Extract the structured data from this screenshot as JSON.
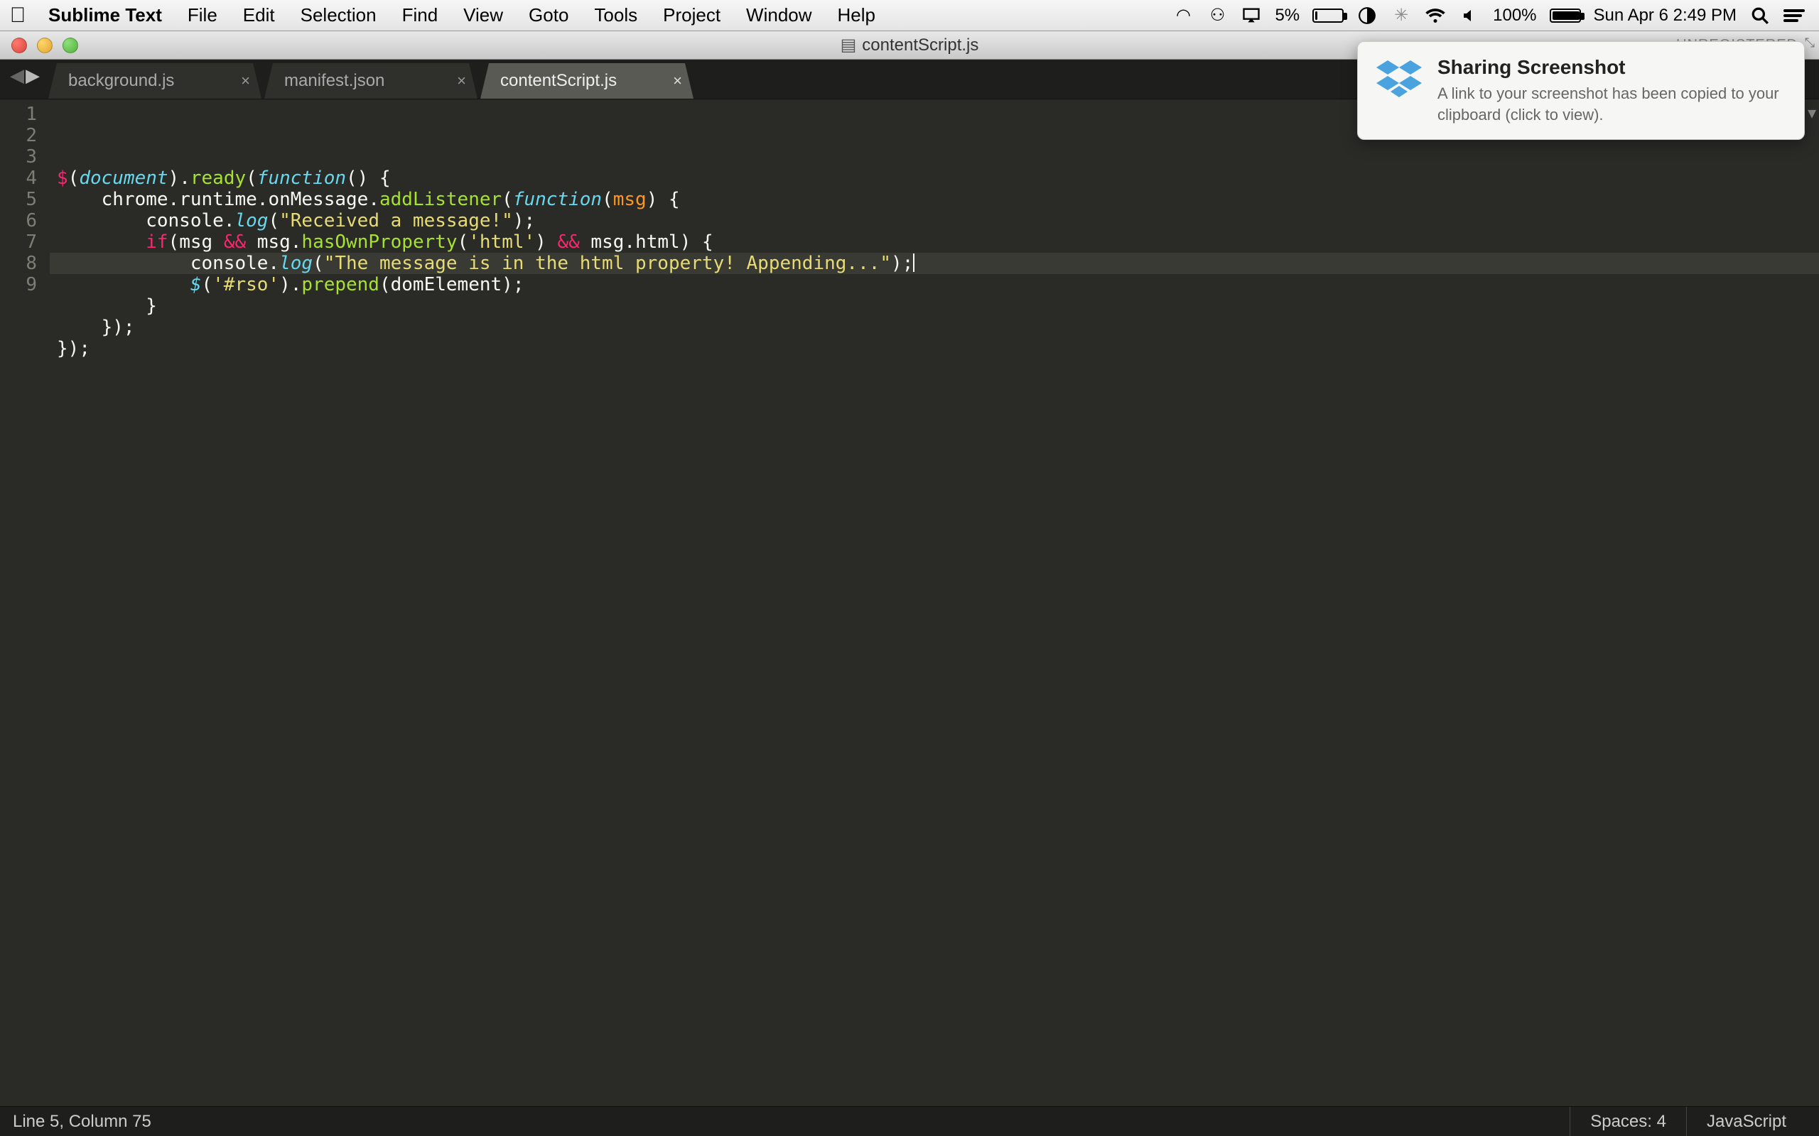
{
  "menubar": {
    "app_name": "Sublime Text",
    "items": [
      "File",
      "Edit",
      "Selection",
      "Find",
      "View",
      "Goto",
      "Tools",
      "Project",
      "Window",
      "Help"
    ],
    "tray": {
      "battery1_pct": "5%",
      "battery2_pct": "100%",
      "datetime": "Sun Apr 6  2:49 PM"
    }
  },
  "window": {
    "title": "contentScript.js",
    "unregistered": "UNREGISTERED"
  },
  "tabs": [
    {
      "label": "background.js",
      "active": false
    },
    {
      "label": "manifest.json",
      "active": false
    },
    {
      "label": "contentScript.js",
      "active": true
    }
  ],
  "editor": {
    "line_numbers": [
      "1",
      "2",
      "3",
      "4",
      "5",
      "6",
      "7",
      "8",
      "9"
    ],
    "highlighted_line_index": 4,
    "code_lines": [
      [
        {
          "t": "$",
          "c": "tok-red"
        },
        {
          "t": "(",
          "c": "tok-white"
        },
        {
          "t": "document",
          "c": "tok-blue"
        },
        {
          "t": ")",
          "c": "tok-white"
        },
        {
          "t": ".",
          "c": "tok-white"
        },
        {
          "t": "ready",
          "c": "tok-green"
        },
        {
          "t": "(",
          "c": "tok-white"
        },
        {
          "t": "function",
          "c": "tok-blue"
        },
        {
          "t": "()",
          "c": "tok-white"
        },
        {
          "t": " {",
          "c": "tok-white"
        }
      ],
      [
        {
          "t": "    chrome",
          "c": "tok-white"
        },
        {
          "t": ".",
          "c": "tok-white"
        },
        {
          "t": "runtime",
          "c": "tok-white"
        },
        {
          "t": ".",
          "c": "tok-white"
        },
        {
          "t": "onMessage",
          "c": "tok-white"
        },
        {
          "t": ".",
          "c": "tok-white"
        },
        {
          "t": "addListener",
          "c": "tok-green"
        },
        {
          "t": "(",
          "c": "tok-white"
        },
        {
          "t": "function",
          "c": "tok-blue"
        },
        {
          "t": "(",
          "c": "tok-white"
        },
        {
          "t": "msg",
          "c": "tok-orange"
        },
        {
          "t": ")",
          "c": "tok-white"
        },
        {
          "t": " {",
          "c": "tok-white"
        }
      ],
      [
        {
          "t": "        console",
          "c": "tok-white"
        },
        {
          "t": ".",
          "c": "tok-white"
        },
        {
          "t": "log",
          "c": "tok-blue"
        },
        {
          "t": "(",
          "c": "tok-white"
        },
        {
          "t": "\"Received a message!\"",
          "c": "tok-yellow"
        },
        {
          "t": ")",
          "c": "tok-white"
        },
        {
          "t": ";",
          "c": "tok-white"
        }
      ],
      [
        {
          "t": "        ",
          "c": "tok-white"
        },
        {
          "t": "if",
          "c": "tok-red"
        },
        {
          "t": "(",
          "c": "tok-white"
        },
        {
          "t": "msg ",
          "c": "tok-white"
        },
        {
          "t": "&&",
          "c": "tok-red"
        },
        {
          "t": " msg",
          "c": "tok-white"
        },
        {
          "t": ".",
          "c": "tok-white"
        },
        {
          "t": "hasOwnProperty",
          "c": "tok-green"
        },
        {
          "t": "(",
          "c": "tok-white"
        },
        {
          "t": "'html'",
          "c": "tok-yellow"
        },
        {
          "t": ")",
          "c": "tok-white"
        },
        {
          "t": " ",
          "c": "tok-white"
        },
        {
          "t": "&&",
          "c": "tok-red"
        },
        {
          "t": " msg",
          "c": "tok-white"
        },
        {
          "t": ".",
          "c": "tok-white"
        },
        {
          "t": "html",
          "c": "tok-white"
        },
        {
          "t": ")",
          "c": "tok-white"
        },
        {
          "t": " {",
          "c": "tok-white"
        }
      ],
      [
        {
          "t": "            console",
          "c": "tok-white"
        },
        {
          "t": ".",
          "c": "tok-white"
        },
        {
          "t": "log",
          "c": "tok-blue"
        },
        {
          "t": "(",
          "c": "tok-white"
        },
        {
          "t": "\"The message is in the html property! Appending...\"",
          "c": "tok-yellow"
        },
        {
          "t": ")",
          "c": "tok-white"
        },
        {
          "t": ";",
          "c": "tok-white"
        }
      ],
      [
        {
          "t": "            ",
          "c": "tok-white"
        },
        {
          "t": "$",
          "c": "tok-blue"
        },
        {
          "t": "(",
          "c": "tok-white"
        },
        {
          "t": "'#rso'",
          "c": "tok-yellow"
        },
        {
          "t": ")",
          "c": "tok-white"
        },
        {
          "t": ".",
          "c": "tok-white"
        },
        {
          "t": "prepend",
          "c": "tok-green"
        },
        {
          "t": "(",
          "c": "tok-white"
        },
        {
          "t": "domElement",
          "c": "tok-white"
        },
        {
          "t": ")",
          "c": "tok-white"
        },
        {
          "t": ";",
          "c": "tok-white"
        }
      ],
      [
        {
          "t": "        }",
          "c": "tok-white"
        }
      ],
      [
        {
          "t": "    })",
          "c": "tok-white"
        },
        {
          "t": ";",
          "c": "tok-white"
        }
      ],
      [
        {
          "t": "})",
          "c": "tok-white"
        },
        {
          "t": ";",
          "c": "tok-white"
        }
      ]
    ]
  },
  "statusbar": {
    "position": "Line 5, Column 75",
    "spaces": "Spaces: 4",
    "syntax": "JavaScript"
  },
  "notification": {
    "title": "Sharing Screenshot",
    "message": "A link to your screenshot has been copied to your clipboard (click to view)."
  }
}
